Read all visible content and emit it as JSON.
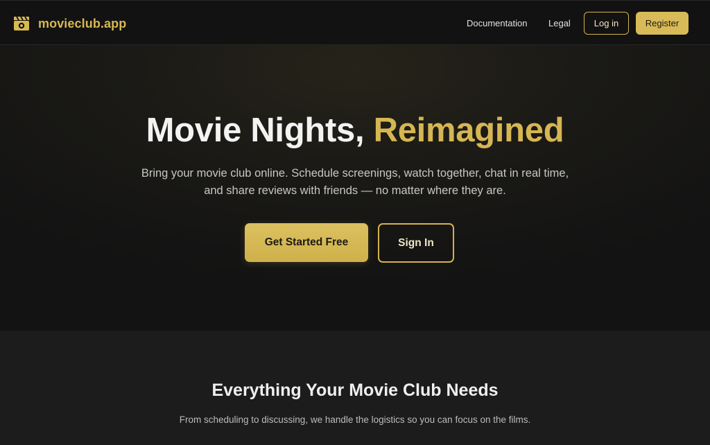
{
  "colors": {
    "accent": "#d6b653",
    "background": "#131313",
    "section_background": "#1c1c1c"
  },
  "navbar": {
    "brand_icon": "film-clapper-icon",
    "brand_name": "movieclub.app",
    "links": [
      "Documentation",
      "Legal"
    ],
    "login_label": "Log in",
    "register_label": "Register"
  },
  "hero": {
    "title_main": "Movie Nights,",
    "title_accent": "Reimagined",
    "subtitle": "Bring your movie club online. Schedule screenings, watch together, chat in real time, and share reviews with friends — no matter where they are.",
    "primary_cta": "Get Started Free",
    "secondary_cta": "Sign In"
  },
  "features": {
    "title": "Everything Your Movie Club Needs",
    "subtitle": "From scheduling to discussing, we handle the logistics so you can focus on the films."
  }
}
